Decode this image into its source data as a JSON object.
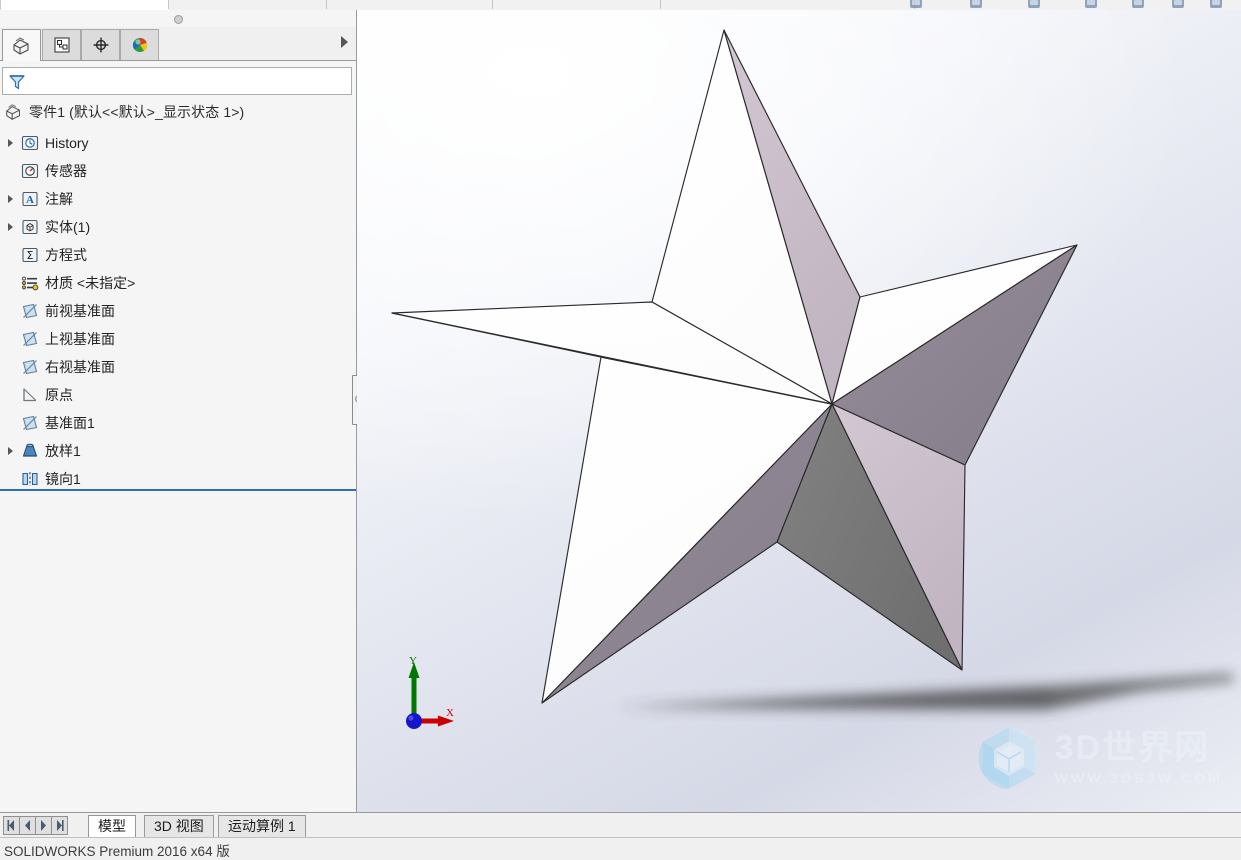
{
  "app": {
    "product": "SOLIDWORKS Premium 2016 x64 版"
  },
  "panel": {
    "tabs": [
      {
        "name": "feature-manager-design-tree",
        "icon": "feature-tree-icon",
        "active": true
      },
      {
        "name": "property-manager",
        "icon": "property-manager-icon",
        "active": false
      },
      {
        "name": "configuration-manager",
        "icon": "configuration-manager-icon",
        "active": false
      },
      {
        "name": "display-manager",
        "icon": "display-manager-icon",
        "active": false
      }
    ],
    "filter": {
      "placeholder": "",
      "value": "",
      "icon": "funnel-icon"
    },
    "root": {
      "label": "零件1  (默认<<默认>_显示状态 1>)",
      "icon": "part-icon"
    },
    "tree": [
      {
        "label": "History",
        "icon": "history-icon",
        "expandable": true
      },
      {
        "label": "传感器",
        "icon": "sensor-icon",
        "expandable": false
      },
      {
        "label": "注解",
        "icon": "annotation-icon",
        "expandable": true
      },
      {
        "label": "实体(1)",
        "icon": "solid-bodies-icon",
        "expandable": true
      },
      {
        "label": "方程式",
        "icon": "equations-icon",
        "expandable": false
      },
      {
        "label": "材质 <未指定>",
        "icon": "material-icon",
        "expandable": false
      },
      {
        "label": "前视基准面",
        "icon": "plane-icon",
        "expandable": false
      },
      {
        "label": "上视基准面",
        "icon": "plane-icon",
        "expandable": false
      },
      {
        "label": "右视基准面",
        "icon": "plane-icon",
        "expandable": false
      },
      {
        "label": "原点",
        "icon": "origin-icon",
        "expandable": false
      },
      {
        "label": "基准面1",
        "icon": "plane-icon",
        "expandable": false
      },
      {
        "label": "放样1",
        "icon": "loft-icon",
        "expandable": true
      },
      {
        "label": "镜向1",
        "icon": "mirror-icon",
        "expandable": false
      }
    ]
  },
  "viewport": {
    "triad": {
      "x_label": "X",
      "y_label": "Y",
      "x_color": "#cc0000",
      "y_color": "#007700",
      "z_color": "#1515cc"
    },
    "model": {
      "name": "five-pointed-star",
      "face_light": "#cbbfcb",
      "face_mid": "#8e8593",
      "face_dark": "#7a7a7a",
      "face_white": "#ffffff",
      "edge_color": "#2a2a2a",
      "shadow_color": "#3a3a3a"
    },
    "watermark": {
      "title": "3D世界网",
      "url": "WWW.3DSJW.COM",
      "logo_color": "#7fc8f0"
    }
  },
  "bottom": {
    "nav": [
      {
        "name": "first-tab-button",
        "glyph": "first"
      },
      {
        "name": "previous-tab-button",
        "glyph": "prev"
      },
      {
        "name": "next-tab-button",
        "glyph": "next"
      },
      {
        "name": "last-tab-button",
        "glyph": "last"
      }
    ],
    "tabs": [
      {
        "label": "模型",
        "active": true
      },
      {
        "label": "3D 视图",
        "active": false
      },
      {
        "label": "运动算例 1",
        "active": false
      }
    ]
  }
}
